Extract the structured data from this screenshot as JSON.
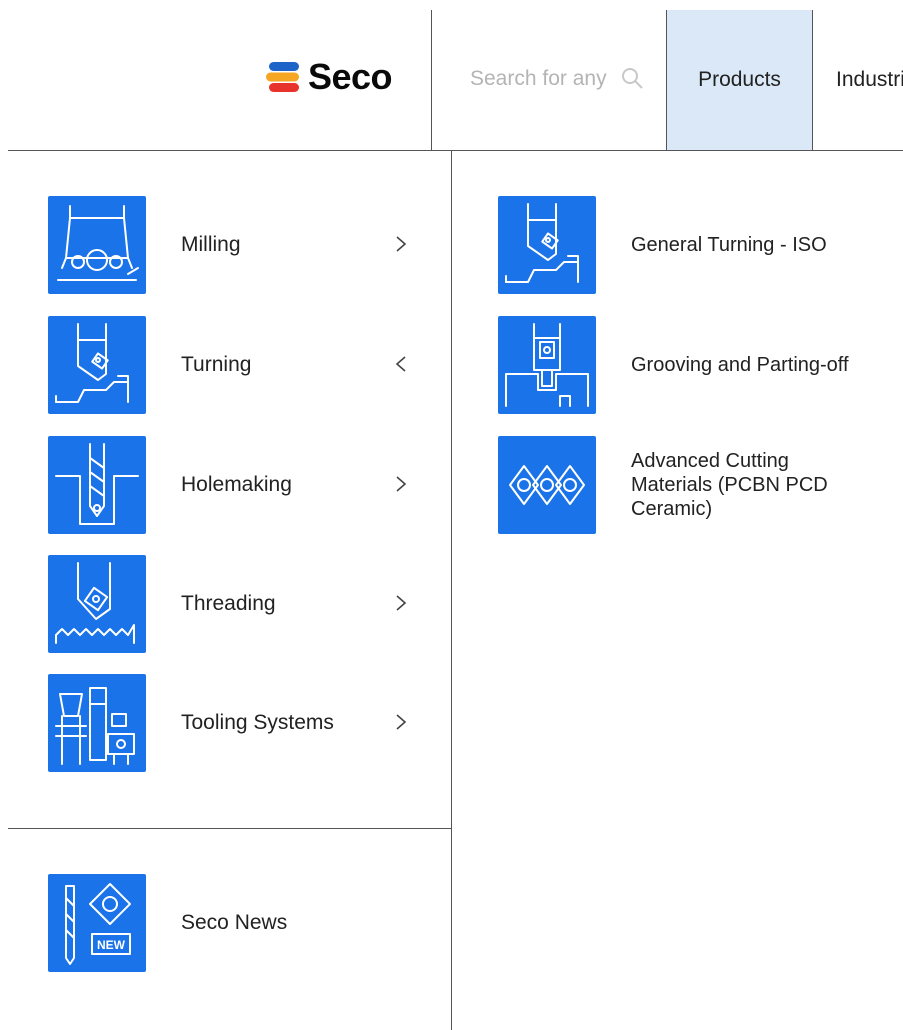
{
  "header": {
    "logo_text": "Seco",
    "search_placeholder": "Search for any",
    "nav_products": "Products",
    "nav_industry": "Industries"
  },
  "menu": {
    "items": [
      {
        "label": "Milling",
        "icon": "milling-icon",
        "expanded": false
      },
      {
        "label": "Turning",
        "icon": "turning-icon",
        "expanded": true
      },
      {
        "label": "Holemaking",
        "icon": "holemaking-icon",
        "expanded": false
      },
      {
        "label": "Threading",
        "icon": "threading-icon",
        "expanded": false
      },
      {
        "label": "Tooling Systems",
        "icon": "tooling-systems-icon",
        "expanded": false
      }
    ],
    "news": {
      "label": "Seco News",
      "icon": "seco-news-icon",
      "badge": "NEW"
    }
  },
  "submenu": {
    "items": [
      {
        "label": "General Turning - ISO",
        "icon": "general-turning-icon"
      },
      {
        "label": "Grooving and Parting-off",
        "icon": "grooving-parting-icon"
      },
      {
        "label": "Advanced Cutting Materials (PCBN PCD Ceramic)",
        "icon": "advanced-cutting-materials-icon"
      }
    ]
  },
  "colors": {
    "accent": "#1a73e8",
    "active_nav_bg": "#dbe8f7",
    "logo_blue": "#1e64c8",
    "logo_orange": "#f5a623",
    "logo_red": "#e8322c"
  }
}
